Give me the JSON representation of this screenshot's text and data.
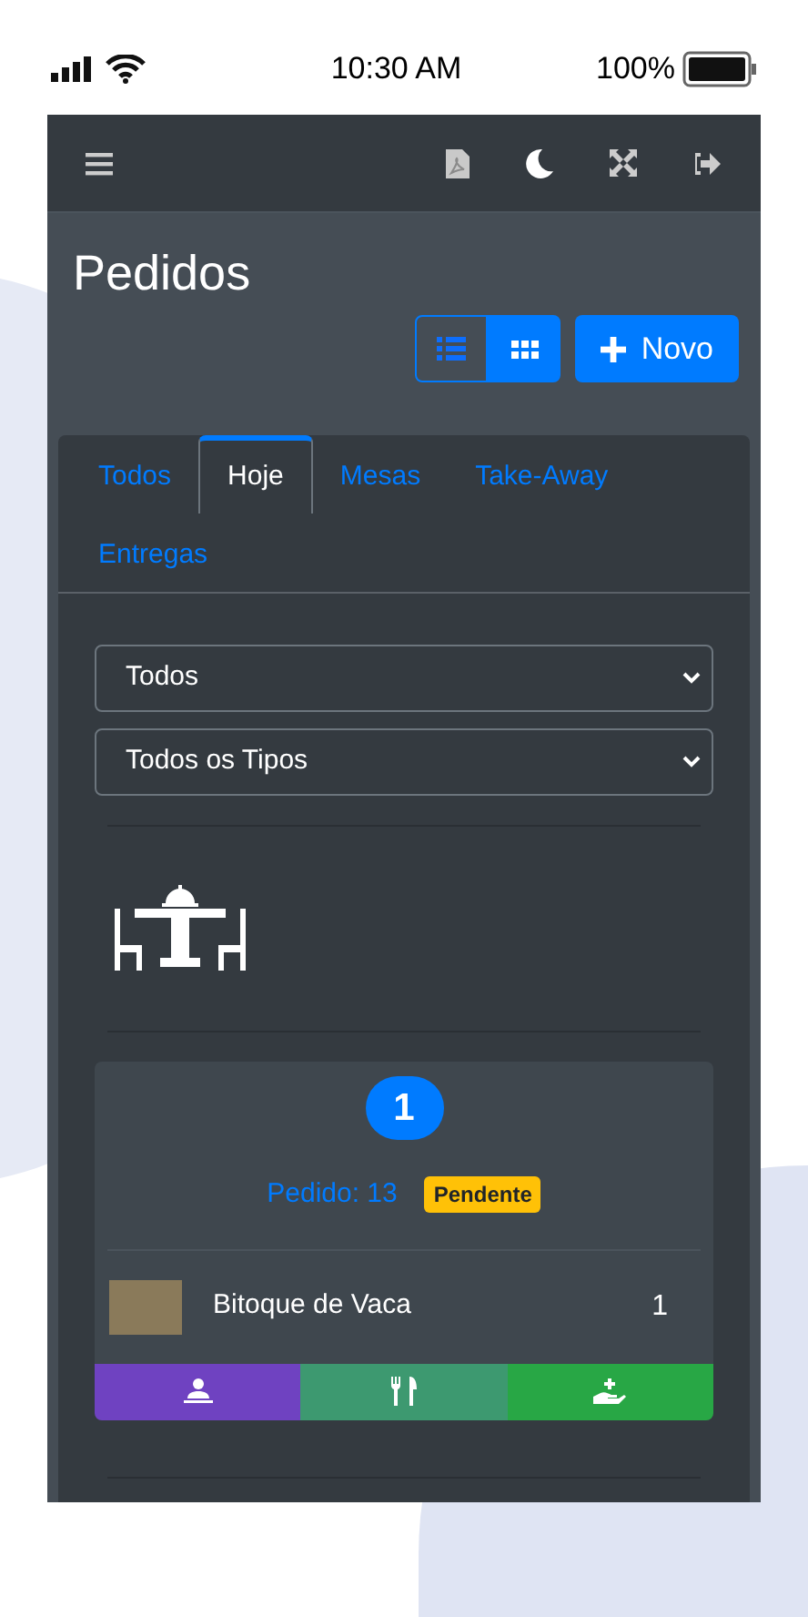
{
  "status_bar": {
    "time": "10:30 AM",
    "battery": "100%"
  },
  "navbar": {
    "actions": [
      {
        "kind": "pdf"
      },
      {
        "kind": "theme"
      },
      {
        "kind": "fullscreen"
      },
      {
        "kind": "logout"
      }
    ]
  },
  "page": {
    "title": "Pedidos",
    "views": [
      {
        "kind": "list",
        "selected": true
      },
      {
        "kind": "grid",
        "selected": false
      }
    ],
    "new_button": "Novo"
  },
  "tabs": [
    {
      "label": "Todos",
      "selected": false
    },
    {
      "label": "Hoje",
      "selected": true
    },
    {
      "label": "Mesas",
      "selected": false
    },
    {
      "label": "Take-Away",
      "selected": false
    },
    {
      "label": "Entregas",
      "selected": false
    }
  ],
  "filters": [
    {
      "value": "Todos"
    },
    {
      "value": "Todos os Tipos"
    }
  ],
  "orders": [
    {
      "number": "1",
      "title": "Pedido: 13",
      "status": "Pendente",
      "items": [
        {
          "name": "Bitoque de Vaca",
          "quantity": "1"
        }
      ],
      "actions": [
        {
          "kind": "waiter",
          "color": "#6f42c1"
        },
        {
          "kind": "cutlery",
          "color": "#3d9970"
        },
        {
          "kind": "hand",
          "color": "#28a745"
        }
      ]
    }
  ]
}
